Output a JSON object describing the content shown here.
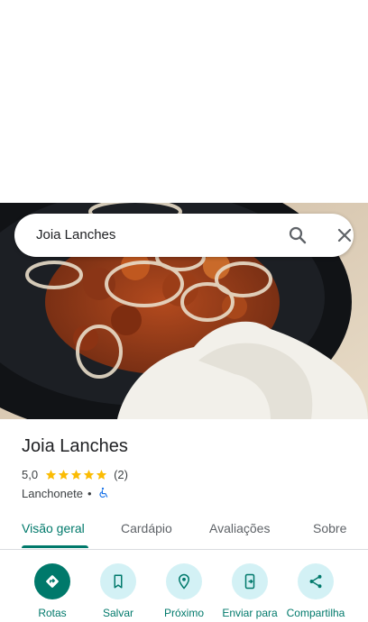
{
  "search": {
    "query": "Joia Lanches"
  },
  "place": {
    "name": "Joia Lanches",
    "rating": "5,0",
    "stars": 5,
    "review_count": "(2)",
    "category": "Lanchonete",
    "separator": "•"
  },
  "tabs": [
    {
      "label": "Visão geral",
      "active": true
    },
    {
      "label": "Cardápio",
      "active": false
    },
    {
      "label": "Avaliações",
      "active": false
    },
    {
      "label": "Sobre",
      "active": false
    }
  ],
  "actions": [
    {
      "label": "Rotas",
      "icon": "directions-icon"
    },
    {
      "label": "Salvar",
      "icon": "bookmark-icon"
    },
    {
      "label": "Próximo",
      "icon": "nearby-icon"
    },
    {
      "label": "Enviar para",
      "icon": "send-to-phone-icon"
    },
    {
      "label": "Compartilha",
      "icon": "share-icon"
    }
  ],
  "colors": {
    "accent": "#00796b",
    "action_bg": "#d3f1f5",
    "star": "#fbbc04",
    "wheelchair": "#1a73e8"
  }
}
